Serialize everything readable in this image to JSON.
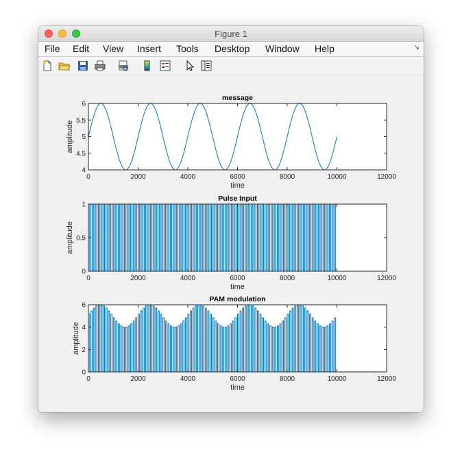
{
  "window": {
    "title": "Figure 1"
  },
  "menu": {
    "items": [
      "File",
      "Edit",
      "View",
      "Insert",
      "Tools",
      "Desktop",
      "Window",
      "Help"
    ]
  },
  "toolbar": {
    "icons": [
      "new-figure-icon",
      "open-file-icon",
      "save-icon",
      "print-icon",
      "print-preview-icon",
      "colorbar-icon",
      "legend-icon",
      "pointer-icon",
      "property-inspector-icon"
    ]
  },
  "chart_data": [
    {
      "type": "line",
      "title": "message",
      "xlabel": "time",
      "ylabel": "amplitude",
      "xlim": [
        0,
        12000
      ],
      "ylim": [
        4,
        6
      ],
      "xticks": [
        0,
        2000,
        4000,
        6000,
        8000,
        10000,
        12000
      ],
      "yticks": [
        4,
        4.5,
        5,
        5.5,
        6
      ],
      "yticklabels": [
        "4",
        "4.5",
        "5",
        "5.5",
        "6"
      ],
      "series": [
        {
          "function": "5 + sin(2*pi*t/2000)",
          "x_range": [
            0,
            10000
          ]
        }
      ]
    },
    {
      "type": "line",
      "title": "Pulse Input",
      "xlabel": "time",
      "ylabel": "amplitude",
      "xlim": [
        0,
        12000
      ],
      "ylim": [
        0,
        1
      ],
      "xticks": [
        0,
        2000,
        4000,
        6000,
        8000,
        10000,
        12000
      ],
      "yticks": [
        0,
        0.5,
        1
      ],
      "yticklabels": [
        "0",
        "0.5",
        "1"
      ],
      "series": [
        {
          "pulse_period": 100,
          "pulse_high": 1,
          "pulse_low": 0,
          "x_range": [
            0,
            10000
          ]
        }
      ]
    },
    {
      "type": "line",
      "title": "PAM modulation",
      "xlabel": "time",
      "ylabel": "amplitude",
      "xlim": [
        0,
        12000
      ],
      "ylim": [
        0,
        6
      ],
      "xticks": [
        0,
        2000,
        4000,
        6000,
        8000,
        10000,
        12000
      ],
      "yticks": [
        0,
        2,
        4,
        6
      ],
      "yticklabels": [
        "0",
        "2",
        "4",
        "6"
      ],
      "series": [
        {
          "pulse_period": 100,
          "envelope": "5 + sin(2*pi*t/2000)",
          "x_range": [
            0,
            10000
          ]
        }
      ]
    }
  ]
}
